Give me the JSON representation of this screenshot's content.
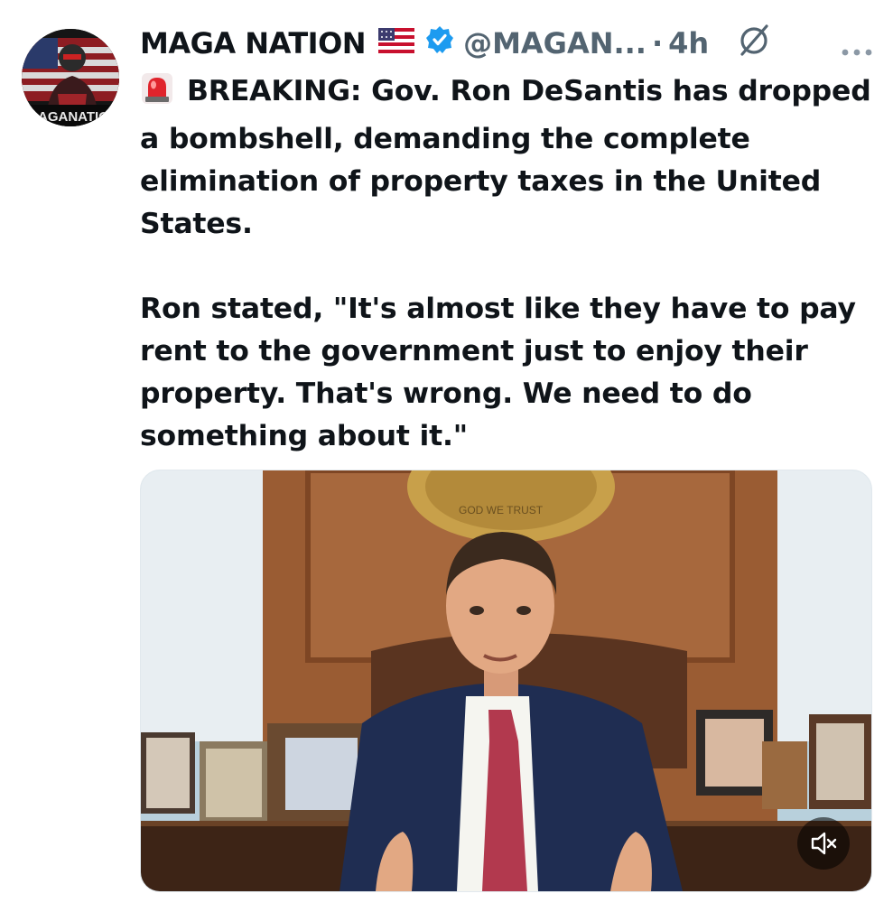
{
  "post": {
    "author_name": "MAGA NATION",
    "author_flag_icon": "us-flag-icon",
    "verified_icon": "verified-badge-icon",
    "handle": "@MAGAN...",
    "separator": "·",
    "time": "4h",
    "avatar_text": "AGANATIO",
    "paragraph_1": "BREAKING: Gov. Ron DeSantis has dropped a bombshell, demanding the complete elimination of property taxes in the United States.",
    "paragraph_2": "Ron stated, \"It's almost like they have to pay rent to the government just to enjoy their property. That's wrong. We need to do something about it.\"",
    "media_seal_text": "GOD WE TRUST"
  },
  "colors": {
    "text": "#0f1419",
    "secondary": "#536471",
    "verified": "#1d9bf0",
    "siren_red": "#e0242c"
  }
}
